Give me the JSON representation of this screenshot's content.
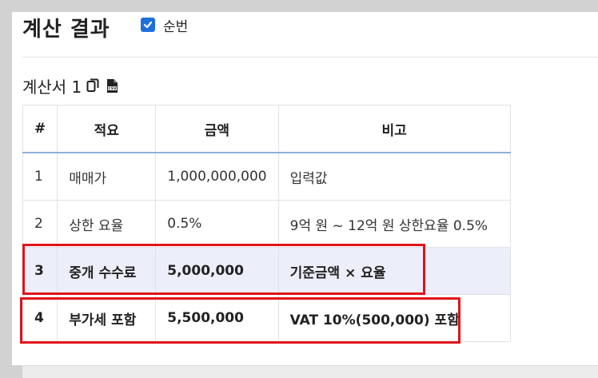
{
  "header": {
    "title": "계산 결과",
    "order_toggle_label": "순번",
    "order_toggle_checked": true
  },
  "sheet": {
    "name": "계산서 1",
    "copy_icon": "copy-icon",
    "csv_icon": "csv-file-icon"
  },
  "table": {
    "headers": [
      "#",
      "적요",
      "금액",
      "비고"
    ],
    "rows": [
      [
        "1",
        "매매가",
        "1,000,000,000",
        "입력값"
      ],
      [
        "2",
        "상한 요율",
        "0.5%",
        "9억 원 ~ 12억 원 상한요율 0.5%"
      ],
      [
        "3",
        "중개 수수료",
        "5,000,000",
        "기준금액 × 요율"
      ],
      [
        "4",
        "부가세 포함",
        "5,500,000",
        "VAT 10%(500,000) 포함"
      ]
    ]
  },
  "colors": {
    "accent": "#1f6fd8",
    "highlight_row": "#eceef9",
    "annotation_box": "#e0131a",
    "header_rule": "#8fb0d8"
  }
}
